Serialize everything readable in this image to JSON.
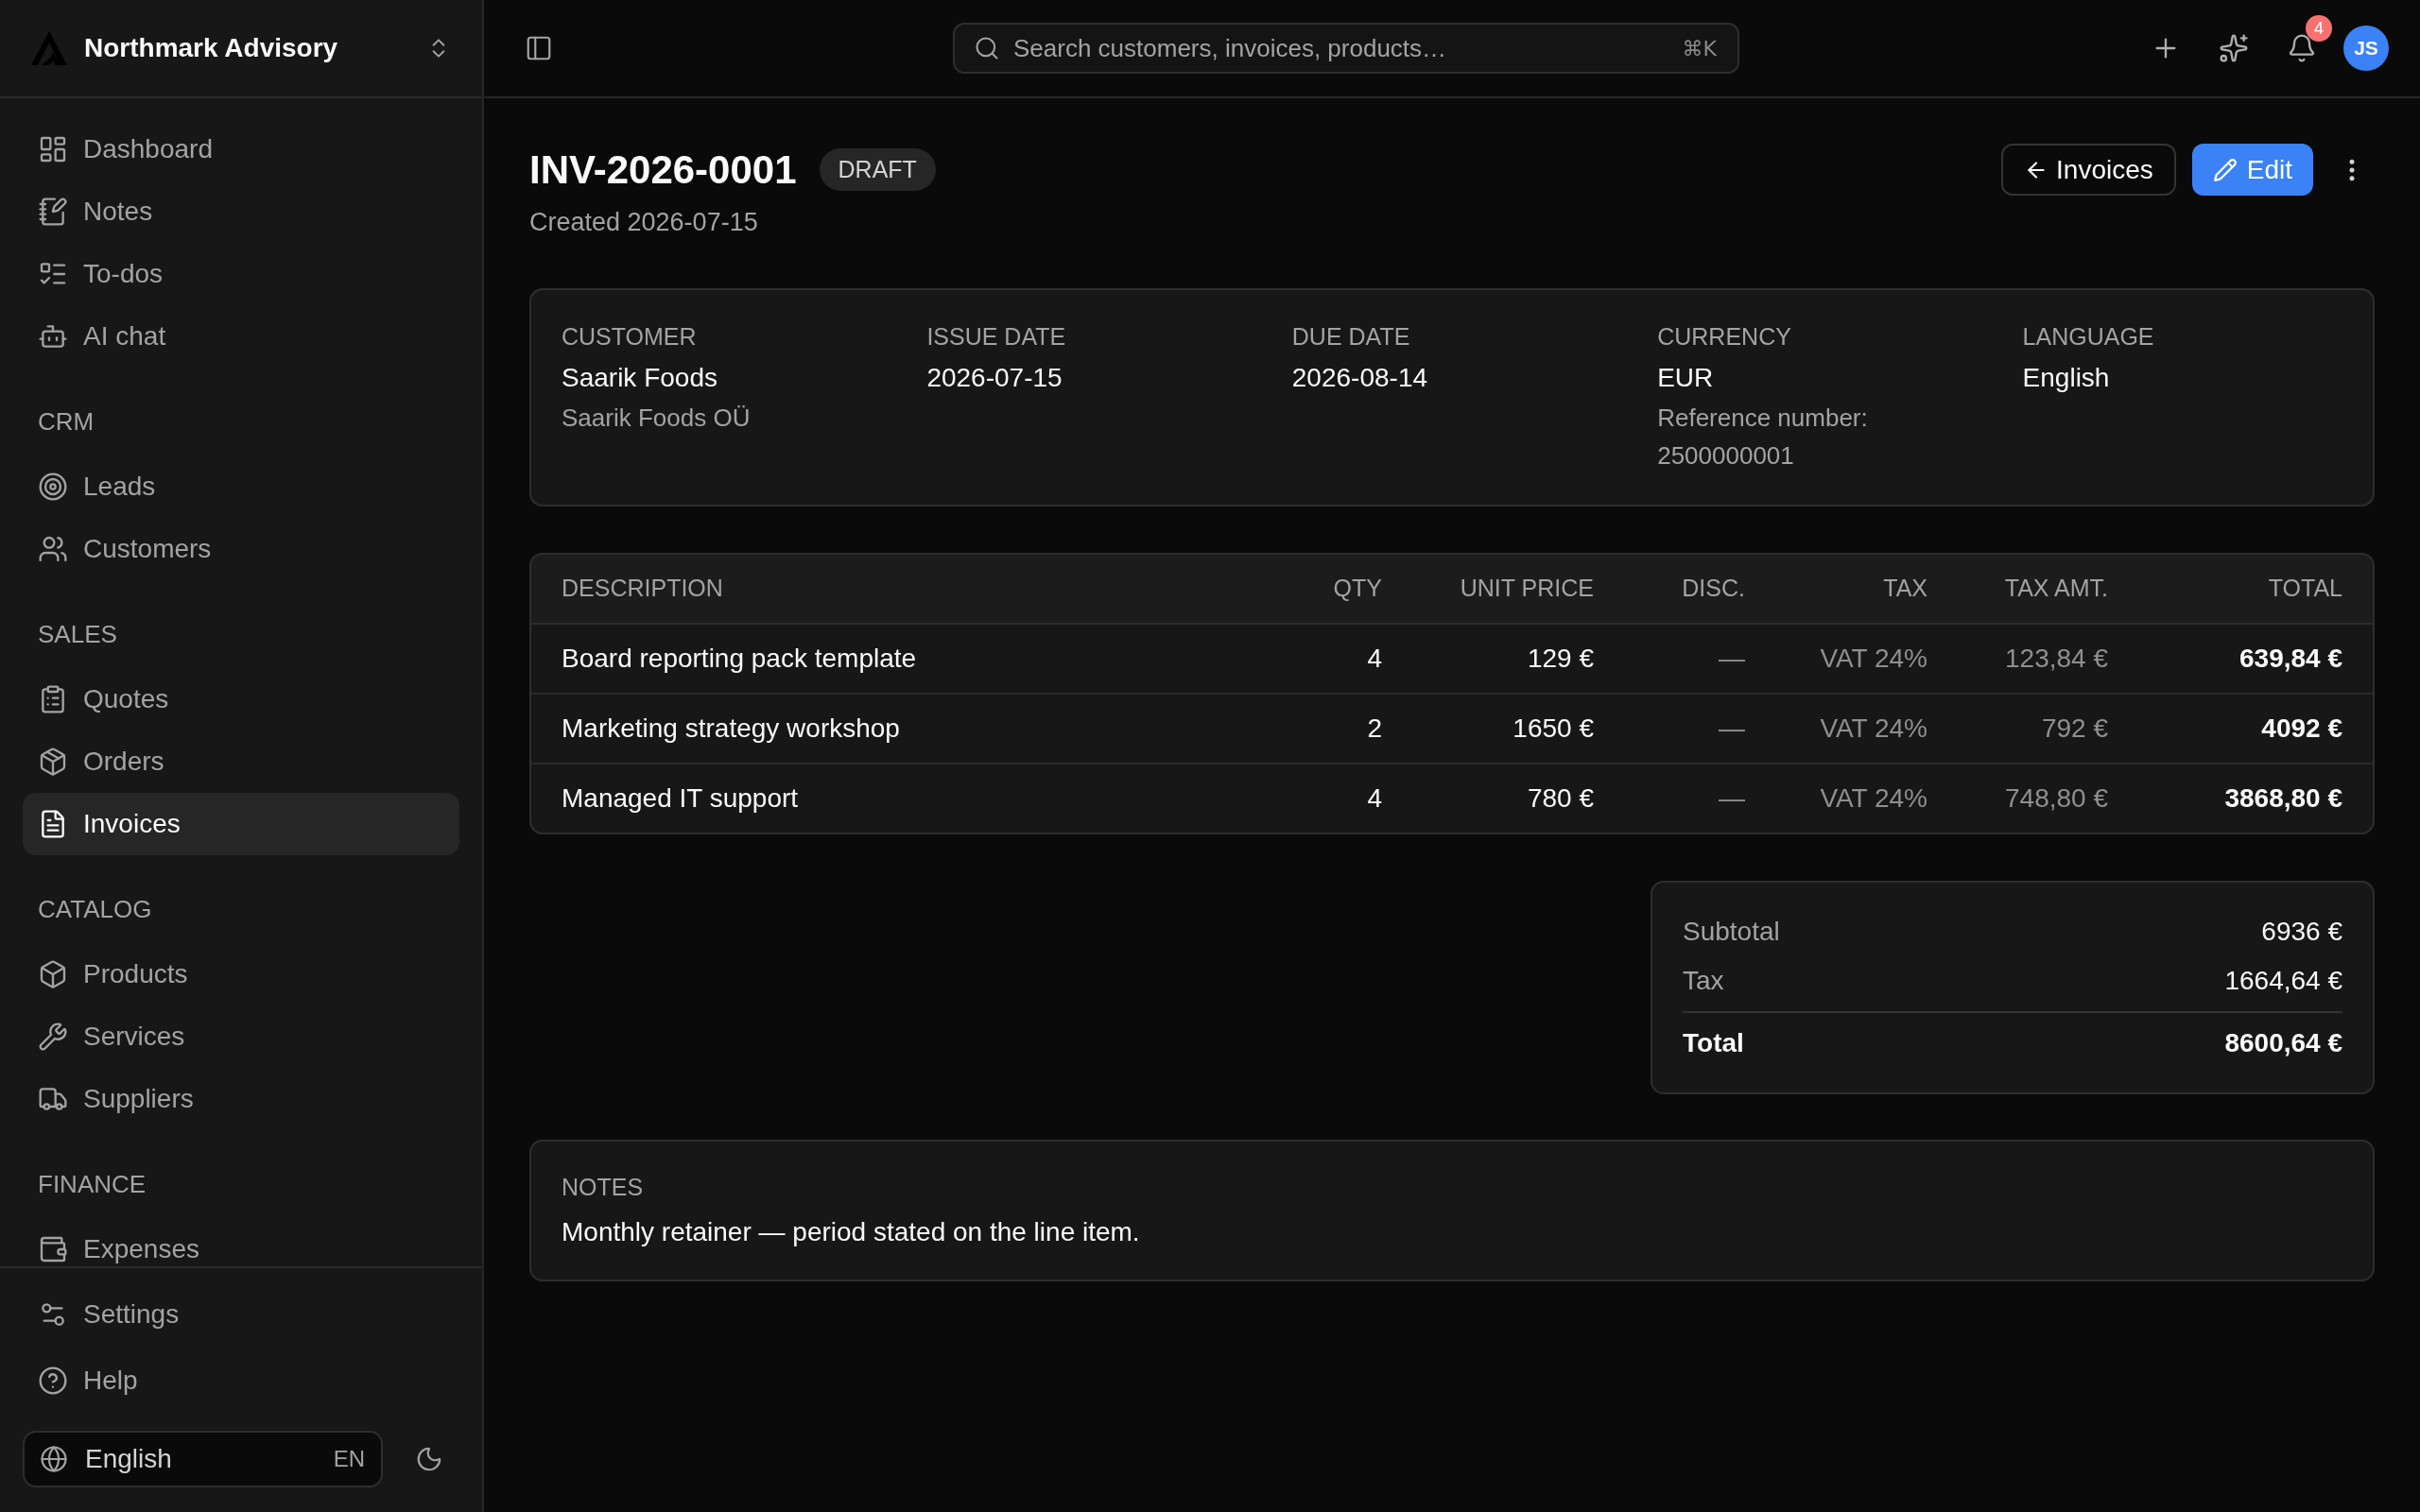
{
  "sidebar": {
    "workspace": "Northmark Advisory",
    "nav_groups": [
      {
        "items": [
          {
            "label": "Dashboard",
            "selected": false
          },
          {
            "label": "Notes",
            "selected": false
          },
          {
            "label": "To-dos",
            "selected": false
          },
          {
            "label": "AI chat",
            "selected": false
          }
        ]
      },
      {
        "title": "CRM",
        "items": [
          {
            "label": "Leads",
            "selected": false
          },
          {
            "label": "Customers",
            "selected": false
          }
        ]
      },
      {
        "title": "SALES",
        "items": [
          {
            "label": "Quotes",
            "selected": false
          },
          {
            "label": "Orders",
            "selected": false
          },
          {
            "label": "Invoices",
            "selected": true
          }
        ]
      },
      {
        "title": "CATALOG",
        "items": [
          {
            "label": "Products",
            "selected": false
          },
          {
            "label": "Services",
            "selected": false
          },
          {
            "label": "Suppliers",
            "selected": false
          }
        ]
      },
      {
        "title": "FINANCE",
        "items": [
          {
            "label": "Expenses",
            "selected": false
          }
        ]
      }
    ],
    "footer_items": [
      {
        "label": "Settings",
        "selected": false
      },
      {
        "label": "Help",
        "selected": false
      }
    ],
    "language": {
      "label": "English",
      "code": "EN"
    }
  },
  "top_bar": {
    "search": {
      "placeholder": "Search customers, invoices, products…",
      "shortcut": "⌘K"
    },
    "notification_count": "4",
    "avatar_initials": "JS"
  },
  "invoice": {
    "number": "INV-2026-0001",
    "status": "DRAFT",
    "created": "Created 2026-07-15",
    "actions": [
      {
        "kind": "back",
        "label": "Invoices"
      },
      {
        "kind": "edit",
        "label": "Edit"
      }
    ],
    "details": [
      {
        "label": "CUSTOMER",
        "value": "Saarik Foods",
        "extra": [
          "Saarik Foods OÜ"
        ]
      },
      {
        "label": "ISSUE DATE",
        "value": "2026-07-15"
      },
      {
        "label": "DUE DATE",
        "value": "2026-08-14"
      },
      {
        "label": "CURRENCY",
        "value": "EUR",
        "extra": [
          "Reference number:",
          "2500000001"
        ]
      },
      {
        "label": "LANGUAGE",
        "value": "English"
      }
    ],
    "table": {
      "columns": [
        "DESCRIPTION",
        "QTY",
        "UNIT PRICE",
        "DISC.",
        "TAX",
        "TAX AMT.",
        "TOTAL"
      ],
      "rows": [
        {
          "cells": [
            "Board reporting pack template",
            "4",
            "129 €",
            "—",
            "VAT 24%",
            "123,84 €",
            "639,84 €"
          ]
        },
        {
          "cells": [
            "Marketing strategy workshop",
            "2",
            "1650 €",
            "—",
            "VAT 24%",
            "792 €",
            "4092 €"
          ]
        },
        {
          "cells": [
            "Managed IT support",
            "4",
            "780 €",
            "—",
            "VAT 24%",
            "748,80 €",
            "3868,80 €"
          ]
        }
      ]
    },
    "totals": [
      {
        "kind": "line",
        "label": "Subtotal",
        "value": "6936 €"
      },
      {
        "kind": "line",
        "label": "Tax",
        "value": "1664,64 €"
      },
      {
        "kind": "grand",
        "label": "Total",
        "value": "8600,64 €"
      }
    ],
    "notes": {
      "title": "NOTES",
      "text": "Monthly retainer — period stated on the line item."
    }
  }
}
